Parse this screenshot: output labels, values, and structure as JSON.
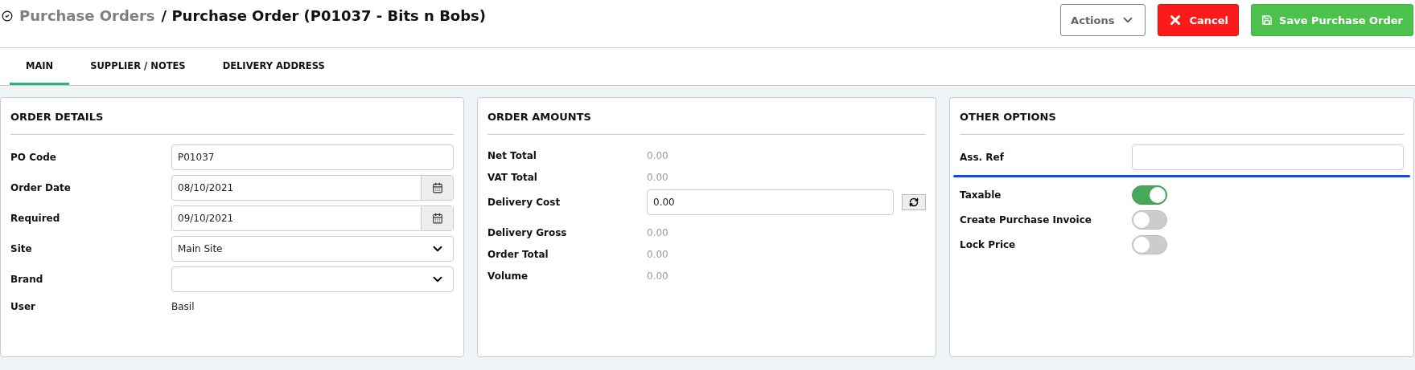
{
  "header": {
    "breadcrumb_parent": "Purchase Orders",
    "title": "/ Purchase Order (P01037 - Bits n Bobs)"
  },
  "actions": [
    {
      "kind": "dropdown",
      "label": "Actions"
    },
    {
      "kind": "danger",
      "label": "Cancel"
    },
    {
      "kind": "success",
      "label": "Save Purchase Order"
    }
  ],
  "tabs": [
    {
      "label": "MAIN",
      "selected": true
    },
    {
      "label": "SUPPLIER / NOTES",
      "selected": false
    },
    {
      "label": "DELIVERY ADDRESS",
      "selected": false
    }
  ],
  "panels": [
    {
      "title": "ORDER DETAILS",
      "rows": [
        {
          "kind": "input",
          "label": "PO Code",
          "value": "P01037"
        },
        {
          "kind": "date",
          "label": "Order Date",
          "value": "08/10/2021"
        },
        {
          "kind": "date",
          "label": "Required",
          "value": "09/10/2021"
        },
        {
          "kind": "select",
          "label": "Site",
          "value": "Main Site"
        },
        {
          "kind": "select",
          "label": "Brand"
        },
        {
          "kind": "text",
          "label": "User",
          "value": "Basil",
          "muted": false
        }
      ]
    },
    {
      "title": "ORDER AMOUNTS",
      "rows": [
        {
          "kind": "text",
          "label": "Net Total",
          "value": "0.00",
          "muted": true
        },
        {
          "kind": "text",
          "label": "VAT Total",
          "value": "0.00",
          "muted": true
        },
        {
          "kind": "refresh-input",
          "label": "Delivery Cost",
          "value": "0.00"
        },
        {
          "kind": "text",
          "label": "Delivery Gross",
          "value": "0.00",
          "muted": true
        },
        {
          "kind": "text",
          "label": "Order Total",
          "value": "0.00",
          "muted": true
        },
        {
          "kind": "text",
          "label": "Volume",
          "value": "0.00",
          "muted": true
        }
      ]
    },
    {
      "title": "OTHER OPTIONS",
      "rows": [
        {
          "kind": "input",
          "label": "Ass. Ref",
          "focused": true
        },
        {
          "kind": "switch",
          "label": "Taxable",
          "on": true
        },
        {
          "kind": "switch",
          "label": "Create Purchase Invoice",
          "on": false
        },
        {
          "kind": "switch",
          "label": "Lock Price",
          "on": false
        }
      ]
    }
  ]
}
